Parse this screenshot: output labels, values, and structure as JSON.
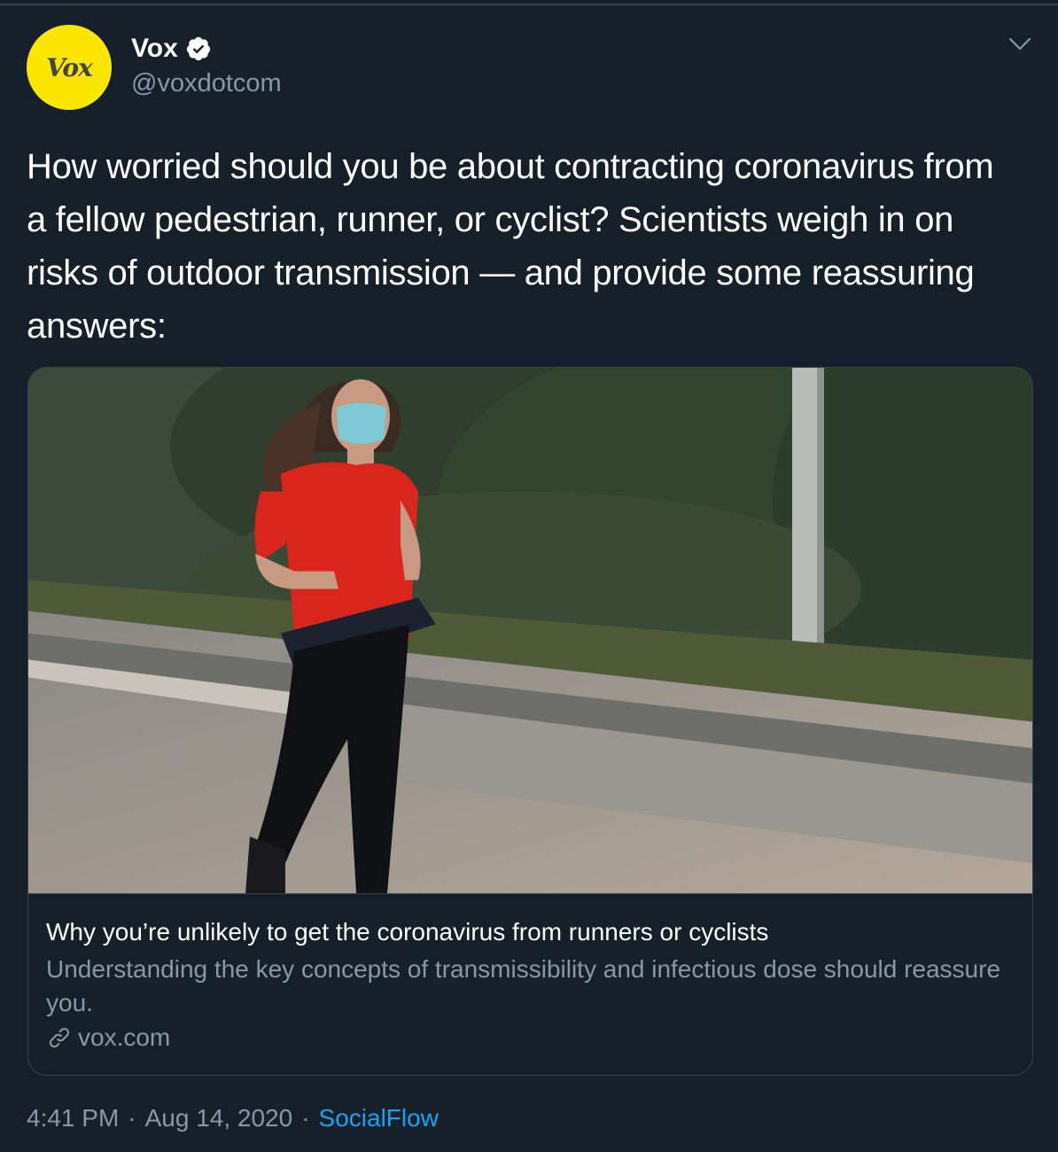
{
  "author": {
    "display_name": "Vox",
    "handle": "@voxdotcom",
    "avatar_text": "Vox",
    "verified": true
  },
  "tweet": {
    "text": "How worried should you be about contracting coronavirus from a fellow pedestrian, runner, or cyclist? Scientists weigh in on risks of outdoor transmission — and provide some reassuring answers:"
  },
  "card": {
    "image_alt": "Woman in red shirt and face mask jogging on a paved path",
    "title": "Why you’re unlikely to get the coronavirus from runners or cyclists",
    "description": "Understanding the key concepts of transmissibility and infectious dose should reassure you.",
    "domain": "vox.com"
  },
  "meta": {
    "time": "4:41 PM",
    "separator": "·",
    "date": "Aug 14, 2020",
    "source": "SocialFlow"
  },
  "icons": {
    "more": "chevron-down-icon",
    "verified": "verified-badge-icon",
    "link": "link-icon"
  },
  "colors": {
    "background": "#15202b",
    "border": "#38444d",
    "secondary_text": "#8899a6",
    "accent": "#1da1f2",
    "avatar_bg": "#fae600"
  }
}
